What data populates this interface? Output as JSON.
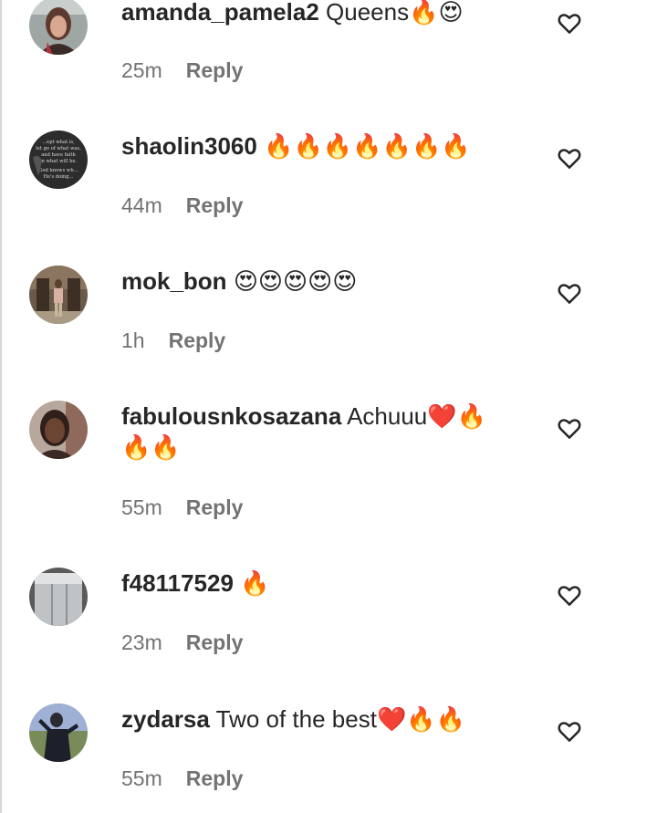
{
  "comments": [
    {
      "username": "amanda_pamela2",
      "text": "Queens",
      "emoji": "🔥😍",
      "time": "25m",
      "reply": "Reply"
    },
    {
      "username": "shaolin3060",
      "text": "",
      "emoji": "🔥🔥🔥🔥🔥🔥🔥",
      "time": "44m",
      "reply": "Reply",
      "avatar_text": [
        "...ept what is,",
        "let go of what was,",
        "and have faith",
        "in what will be.",
        "God knows wh...",
        "He's doing..."
      ]
    },
    {
      "username": "mok_bon",
      "text": "",
      "emoji": "😍😍😍😍😍",
      "time": "1h",
      "reply": "Reply"
    },
    {
      "username": "fabulousnkosazana",
      "text": "Achuuu",
      "emoji": "❤️🔥",
      "emoji_line2": "🔥🔥",
      "time": "55m",
      "reply": "Reply"
    },
    {
      "username": "f48117529",
      "text": "",
      "emoji": "🔥",
      "time": "23m",
      "reply": "Reply"
    },
    {
      "username": "zydarsa",
      "text": "Two of the best",
      "emoji": "❤️🔥🔥",
      "time": "55m",
      "reply": "Reply"
    }
  ],
  "icons": {
    "like": "heart-outline-icon"
  }
}
